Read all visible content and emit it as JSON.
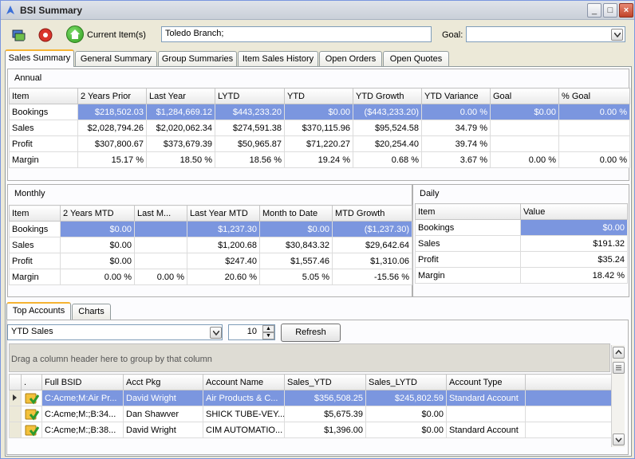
{
  "window": {
    "title": "BSI Summary"
  },
  "toolbar": {
    "current_items_label": "Current Item(s)",
    "current_items_value": "Toledo Branch;",
    "goal_label": "Goal:",
    "goal_value": ""
  },
  "tabs": [
    "Sales Summary",
    "General Summary",
    "Group Summaries",
    "Item Sales History",
    "Open Orders",
    "Open Quotes"
  ],
  "annual": {
    "title": "Annual",
    "headers": [
      "Item",
      "2 Years Prior",
      "Last Year",
      "LYTD",
      "YTD",
      "YTD Growth",
      "YTD Variance",
      "Goal",
      "% Goal"
    ],
    "rows": [
      [
        "Bookings",
        "$218,502.03",
        "$1,284,669.12",
        "$443,233.20",
        "$0.00",
        "($443,233.20)",
        "0.00 %",
        "$0.00",
        "0.00 %"
      ],
      [
        "Sales",
        "$2,028,794.26",
        "$2,020,062.34",
        "$274,591.38",
        "$370,115.96",
        "$95,524.58",
        "34.79 %",
        "",
        ""
      ],
      [
        "Profit",
        "$307,800.67",
        "$373,679.39",
        "$50,965.87",
        "$71,220.27",
        "$20,254.40",
        "39.74 %",
        "",
        ""
      ],
      [
        "Margin",
        "15.17 %",
        "18.50 %",
        "18.56 %",
        "19.24 %",
        "0.68 %",
        "3.67 %",
        "0.00 %",
        "0.00 %"
      ]
    ]
  },
  "monthly": {
    "title": "Monthly",
    "headers": [
      "Item",
      "2 Years MTD",
      "Last M...",
      "Last Year MTD",
      "Month to Date",
      "MTD Growth"
    ],
    "rows": [
      [
        "Bookings",
        "$0.00",
        "",
        "$1,237.30",
        "$0.00",
        "($1,237.30)"
      ],
      [
        "Sales",
        "$0.00",
        "",
        "$1,200.68",
        "$30,843.32",
        "$29,642.64"
      ],
      [
        "Profit",
        "$0.00",
        "",
        "$247.40",
        "$1,557.46",
        "$1,310.06"
      ],
      [
        "Margin",
        "0.00 %",
        "0.00 %",
        "20.60 %",
        "5.05 %",
        "-15.56 %"
      ]
    ]
  },
  "daily": {
    "title": "Daily",
    "headers": [
      "Item",
      "Value"
    ],
    "rows": [
      [
        "Bookings",
        "$0.00"
      ],
      [
        "Sales",
        "$191.32"
      ],
      [
        "Profit",
        "$35.24"
      ],
      [
        "Margin",
        "18.42 %"
      ]
    ]
  },
  "bottom_tabs": [
    "Top Accounts",
    "Charts"
  ],
  "top_accounts": {
    "metric": "YTD Sales",
    "count": "10",
    "refresh_label": "Refresh",
    "group_hint": "Drag a column header here to group by that column",
    "headers": [
      ".",
      "Full BSID",
      "Acct Pkg",
      "Account Name",
      "Sales_YTD",
      "Sales_LYTD",
      "Account Type"
    ],
    "rows": [
      [
        "C:Acme;M:Air Pr...",
        "David Wright",
        "Air Products & C...",
        "$356,508.25",
        "$245,802.59",
        "Standard Account"
      ],
      [
        "C:Acme;M:;B:34...",
        "Dan Shawver",
        "SHICK TUBE-VEY...",
        "$5,675.39",
        "$0.00",
        ""
      ],
      [
        "C:Acme;M:;B:38...",
        "David Wright",
        "CIM AUTOMATIO...",
        "$1,396.00",
        "$0.00",
        "Standard Account"
      ]
    ]
  }
}
